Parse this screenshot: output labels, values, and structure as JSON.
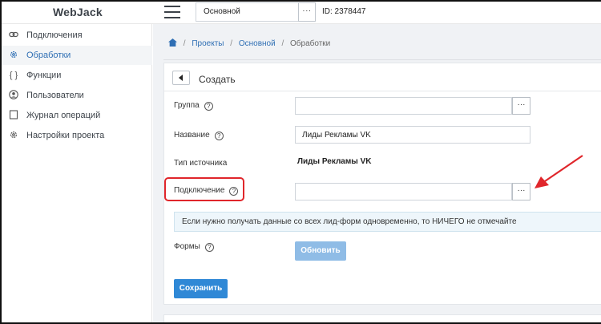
{
  "app": {
    "logo": "WebJack"
  },
  "topbar": {
    "project_select": "Основной",
    "project_dots": "···",
    "project_id": "ID: 2378447"
  },
  "sidebar": {
    "items": [
      {
        "label": "Подключения",
        "icon": "link-icon"
      },
      {
        "label": "Обработки",
        "icon": "gear-icon"
      },
      {
        "label": "Функции",
        "icon": "braces-icon"
      },
      {
        "label": "Пользователи",
        "icon": "user-icon"
      },
      {
        "label": "Журнал операций",
        "icon": "log-icon"
      },
      {
        "label": "Настройки проекта",
        "icon": "settings-icon"
      }
    ],
    "active_index": 1
  },
  "breadcrumb": {
    "items": [
      "Проекты",
      "Основной",
      "Обработки"
    ],
    "separator": "/"
  },
  "form": {
    "title": "Создать",
    "group_label": "Группа",
    "group_value": "",
    "name_label": "Название",
    "name_value": "Лиды Рекламы VK",
    "source_type_label": "Тип источника",
    "source_type_value": "Лиды Рекламы VK",
    "connection_label": "Подключение",
    "connection_value": "",
    "dots": "···",
    "info_text": "Если нужно получать данные со всех лид-форм одновременно, то НИЧЕГО не отмечайте",
    "forms_label": "Формы",
    "refresh_button": "Обновить",
    "save_button": "Сохранить",
    "help_glyph": "?"
  },
  "colors": {
    "accent": "#2f88d6",
    "link": "#2f6fb4",
    "annotation": "#e0262b",
    "refresh_disabled": "#8fbce6"
  }
}
